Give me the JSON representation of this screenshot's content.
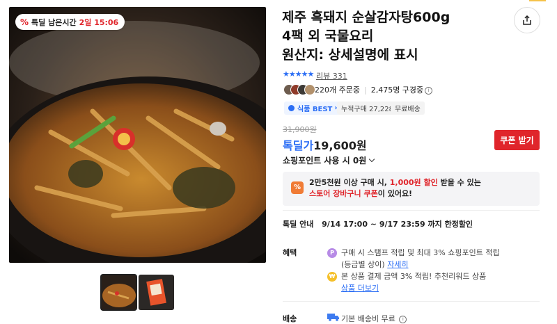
{
  "timer": {
    "label": "특딜 남은시간",
    "remaining": "2일 15:06"
  },
  "product": {
    "title_lines": [
      "제주 흑돼지 순살감자탕600g",
      "4팩 외 국물요리",
      "원산지: 상세설명에 표시"
    ],
    "rating_stars": "★★★★★",
    "review_label": "리뷰 331",
    "orders": "220개 주문중",
    "subscribers": "2,475명 구경중"
  },
  "badges": {
    "best": "식품 BEST",
    "cumulative": "누적구매 27,228",
    "free_ship": "무료배송"
  },
  "pricing": {
    "original": "31,900원",
    "deal_label": "톡딜가",
    "deal_price": "19,600원",
    "coupon_button": "쿠폰 받기",
    "point_label": "쇼핑포인트 사용 시",
    "point_price": "0원"
  },
  "promo": {
    "icon": "%",
    "line1_a": "2만5천원 이상 구매 시, ",
    "line1_red": "1,000원 할인",
    "line1_b": " 받을 수 있는",
    "line2_red": "스토어 장바구니 쿠폰",
    "line2_b": "이 있어요!"
  },
  "deal_info": {
    "label": "톡딜 안내",
    "period": "9/14 17:00 ~ 9/17 23:59 까지 한정할인"
  },
  "benefits": {
    "label": "혜택",
    "items": [
      {
        "icon": "P",
        "line1": "구매 시 스탬프 적립 및 최대 3% 쇼핑포인트 적립",
        "line2": "(등급별 상이)",
        "link": "자세히"
      },
      {
        "icon": "₩",
        "line1": "본 상품 결제 금액 3% 적립! 추천리워드 상품",
        "line2": "",
        "link": "상품 더보기"
      }
    ]
  },
  "shipping": {
    "label": "배송",
    "text": "기본 배송비 무료"
  },
  "colors": {
    "accent_blue": "#2b6ef5",
    "accent_red": "#e0252b",
    "promo_orange": "#f07b35"
  },
  "icons": [
    "percent-icon",
    "share-icon",
    "star-icon",
    "info-icon",
    "point-icon",
    "won-icon",
    "truck-icon"
  ]
}
